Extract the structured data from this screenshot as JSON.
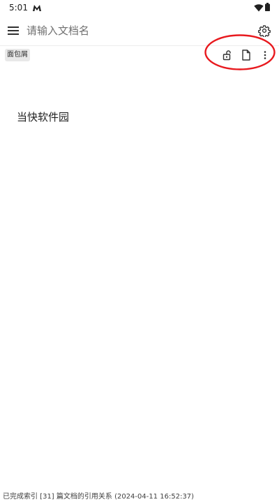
{
  "status_bar": {
    "time": "5:01",
    "app_icon": "m-logo-icon",
    "wifi_icon": "wifi-icon",
    "battery_icon": "battery-icon"
  },
  "app_bar": {
    "menu_icon": "hamburger-menu-icon",
    "search_placeholder": "请输入文档名",
    "settings_icon": "gear-icon"
  },
  "toolbar": {
    "breadcrumb": "面包屑",
    "icons": [
      "unlock-icon",
      "document-icon",
      "more-vert-icon"
    ]
  },
  "document": {
    "title": "当快软件园"
  },
  "footer": {
    "status_text": "已完成索引 [31] 篇文档的引用关系 (2024-04-11 16:52:37)"
  },
  "colors": {
    "highlight_circle": "#e8191e",
    "text_primary": "#202020",
    "placeholder": "#707070",
    "chip_background": "#e8e8e8"
  }
}
